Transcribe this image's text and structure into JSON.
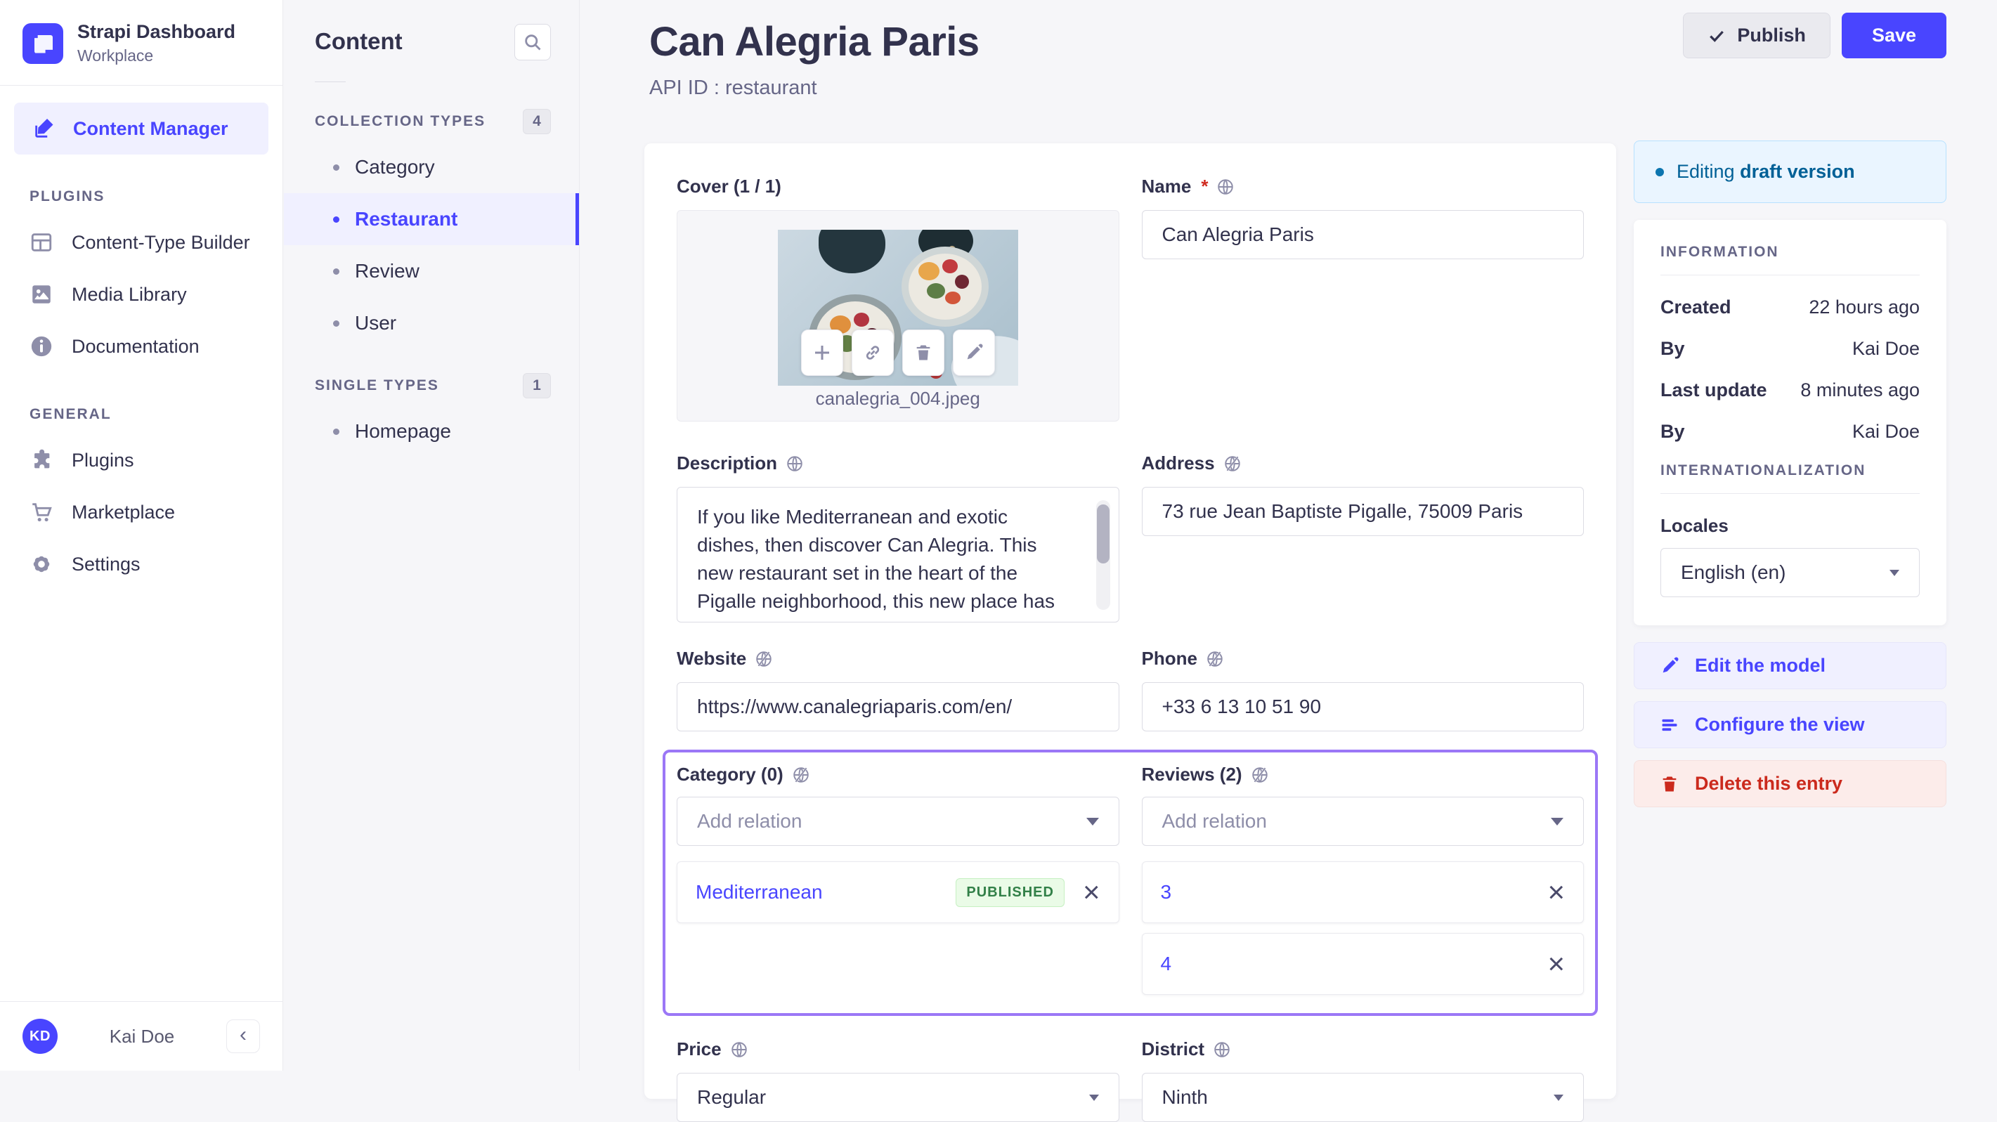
{
  "colors": {
    "accent": "#4945ff",
    "accent_light_bg": "#f0f0ff",
    "focus_outline": "#9b77f6",
    "success_text": "#328048",
    "success_bg": "#eafbe7",
    "danger_text": "#cb2a1d",
    "danger_bg": "#fcecea",
    "info_text": "#006096",
    "info_bg": "#eaf5ff"
  },
  "brand": {
    "title": "Strapi Dashboard",
    "subtitle": "Workplace"
  },
  "mainnav": {
    "content_manager": "Content Manager",
    "sections": [
      {
        "title": "PLUGINS",
        "items": [
          {
            "label": "Content-Type Builder"
          },
          {
            "label": "Media Library"
          },
          {
            "label": "Documentation"
          }
        ]
      },
      {
        "title": "GENERAL",
        "items": [
          {
            "label": "Plugins"
          },
          {
            "label": "Marketplace"
          },
          {
            "label": "Settings"
          }
        ]
      }
    ],
    "user": {
      "initials": "KD",
      "name": "Kai Doe"
    },
    "collapse": "‹"
  },
  "subnav": {
    "title": "Content",
    "groups": [
      {
        "title": "COLLECTION TYPES",
        "count": "4",
        "items": [
          {
            "label": "Category"
          },
          {
            "label": "Restaurant"
          },
          {
            "label": "Review"
          },
          {
            "label": "User"
          }
        ]
      },
      {
        "title": "SINGLE TYPES",
        "count": "1",
        "items": [
          {
            "label": "Homepage"
          }
        ]
      }
    ]
  },
  "header": {
    "title": "Can Alegria Paris",
    "api_id": "API ID : restaurant",
    "publish_label": "Publish",
    "save_label": "Save"
  },
  "form": {
    "cover": {
      "label": "Cover (1 / 1)",
      "filename": "canalegria_004.jpeg"
    },
    "name": {
      "label": "Name",
      "required": "*",
      "value": "Can Alegria Paris"
    },
    "description": {
      "label": "Description",
      "value": "If you like Mediterranean and exotic dishes, then discover Can Alegria. This new restaurant set in the heart of the Pigalle neighborhood, this new place has been"
    },
    "address": {
      "label": "Address",
      "value": "73 rue Jean Baptiste Pigalle, 75009 Paris"
    },
    "website": {
      "label": "Website",
      "value": "https://www.canalegriaparis.com/en/"
    },
    "phone": {
      "label": "Phone",
      "value": "+33 6 13 10 51 90"
    },
    "category": {
      "label": "Category (0)",
      "placeholder": "Add relation",
      "items": [
        {
          "name": "Mediterranean",
          "badge": "PUBLISHED",
          "close": "×"
        }
      ]
    },
    "reviews": {
      "label": "Reviews (2)",
      "placeholder": "Add relation",
      "items": [
        {
          "name": "3",
          "close": "×"
        },
        {
          "name": "4",
          "close": "×"
        }
      ]
    },
    "price": {
      "label": "Price",
      "value": "Regular"
    },
    "district": {
      "label": "District",
      "value": "Ninth"
    }
  },
  "side": {
    "draft_banner": {
      "prefix": "Editing",
      "bold": "draft version"
    },
    "information": {
      "title": "INFORMATION",
      "rows": [
        {
          "k": "Created",
          "v": "22 hours ago"
        },
        {
          "k": "By",
          "v": "Kai Doe"
        },
        {
          "k": "Last update",
          "v": "8 minutes ago"
        },
        {
          "k": "By",
          "v": "Kai Doe"
        }
      ]
    },
    "i18n": {
      "title": "INTERNATIONALIZATION",
      "locales_label": "Locales",
      "locale_value": "English (en)"
    },
    "actions": {
      "edit_model": "Edit the model",
      "configure_view": "Configure the view",
      "delete_entry": "Delete this entry"
    }
  }
}
